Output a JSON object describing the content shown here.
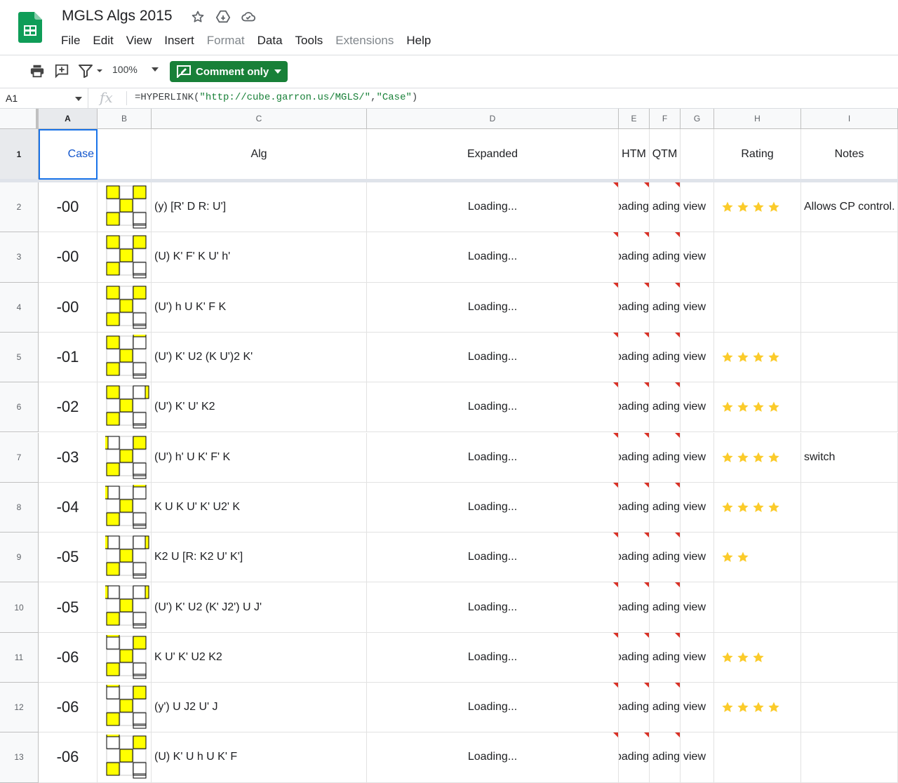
{
  "document": {
    "title": "MGLS Algs 2015",
    "title_icons": [
      "star-icon",
      "move-to-drive-icon",
      "cloud-saved-icon"
    ]
  },
  "menubar": [
    {
      "label": "File",
      "enabled": true
    },
    {
      "label": "Edit",
      "enabled": true
    },
    {
      "label": "View",
      "enabled": true
    },
    {
      "label": "Insert",
      "enabled": true
    },
    {
      "label": "Format",
      "enabled": false
    },
    {
      "label": "Data",
      "enabled": true
    },
    {
      "label": "Tools",
      "enabled": true
    },
    {
      "label": "Extensions",
      "enabled": false
    },
    {
      "label": "Help",
      "enabled": true
    }
  ],
  "toolbar": {
    "icons": [
      "print-icon",
      "add-comment-icon",
      "filter-icon"
    ],
    "zoom": "100%",
    "comment_only_label": "Comment only"
  },
  "formula_bar": {
    "cell_ref": "A1",
    "fx_label": "fx",
    "formula_prefix": "=HYPERLINK(",
    "formula_arg1": "\"http://cube.garron.us/MGLS/\"",
    "formula_sep": ",",
    "formula_arg2": "\"Case\"",
    "formula_suffix": ")"
  },
  "columns": [
    "A",
    "B",
    "C",
    "D",
    "E",
    "F",
    "G",
    "H",
    "I"
  ],
  "header_row": {
    "row_number": "1",
    "case": "Case",
    "alg": "Alg",
    "expanded": "Expanded",
    "htm": "HTM",
    "qtm": "QTM",
    "view": "",
    "rating": "Rating",
    "notes": "Notes"
  },
  "rows": [
    {
      "num": "2",
      "case": "-00",
      "alg": "(y) [R' D R: U']",
      "expanded": "Loading...",
      "htm": "oading",
      "qtm": "ading",
      "view": "view",
      "rating": 4,
      "notes": "Allows CP control.",
      "thumb": [
        [
          1,
          0,
          1
        ],
        [
          0,
          1,
          0
        ],
        [
          1,
          0,
          2
        ]
      ]
    },
    {
      "num": "3",
      "case": "-00",
      "alg": "(U) K' F' K U' h'",
      "expanded": "Loading...",
      "htm": "oading",
      "qtm": "ading",
      "view": "view",
      "rating": 0,
      "notes": "",
      "thumb": [
        [
          1,
          0,
          1
        ],
        [
          0,
          1,
          0
        ],
        [
          1,
          0,
          2
        ]
      ]
    },
    {
      "num": "4",
      "case": "-00",
      "alg": "(U') h U K' F K",
      "expanded": "Loading...",
      "htm": "oading",
      "qtm": "ading",
      "view": "view",
      "rating": 0,
      "notes": "",
      "thumb": [
        [
          1,
          0,
          1
        ],
        [
          0,
          1,
          0
        ],
        [
          1,
          0,
          2
        ]
      ]
    },
    {
      "num": "5",
      "case": "-01",
      "alg": "(U') K' U2 (K U')2 K'",
      "expanded": "Loading...",
      "htm": "oading",
      "qtm": "ading",
      "view": "view",
      "rating": 4,
      "notes": "",
      "thumb": [
        [
          1,
          0,
          3
        ],
        [
          0,
          1,
          0
        ],
        [
          1,
          0,
          2
        ]
      ]
    },
    {
      "num": "6",
      "case": "-02",
      "alg": "(U') K' U' K2",
      "expanded": "Loading...",
      "htm": "oading",
      "qtm": "ading",
      "view": "view",
      "rating": 4,
      "notes": "",
      "thumb": [
        [
          1,
          0,
          4
        ],
        [
          0,
          1,
          0
        ],
        [
          1,
          0,
          2
        ]
      ]
    },
    {
      "num": "7",
      "case": "-03",
      "alg": "(U') h' U K' F' K",
      "expanded": "Loading...",
      "htm": "oading",
      "qtm": "ading",
      "view": "view",
      "rating": 4,
      "notes": "switch",
      "thumb": [
        [
          5,
          0,
          1
        ],
        [
          0,
          1,
          0
        ],
        [
          1,
          0,
          2
        ]
      ]
    },
    {
      "num": "8",
      "case": "-04",
      "alg": "K U K U' K' U2' K",
      "expanded": "Loading...",
      "htm": "oading",
      "qtm": "ading",
      "view": "view",
      "rating": 4,
      "notes": "",
      "thumb": [
        [
          5,
          0,
          3
        ],
        [
          0,
          1,
          0
        ],
        [
          1,
          0,
          2
        ]
      ]
    },
    {
      "num": "9",
      "case": "-05",
      "alg": "K2 U [R: K2 U' K']",
      "expanded": "Loading...",
      "htm": "oading",
      "qtm": "ading",
      "view": "view",
      "rating": 2,
      "notes": "",
      "thumb": [
        [
          5,
          0,
          4
        ],
        [
          0,
          1,
          0
        ],
        [
          1,
          0,
          2
        ]
      ]
    },
    {
      "num": "10",
      "case": "-05",
      "alg": "(U') K' U2 (K' J2') U J'",
      "expanded": "Loading...",
      "htm": "oading",
      "qtm": "ading",
      "view": "view",
      "rating": 0,
      "notes": "",
      "thumb": [
        [
          5,
          0,
          4
        ],
        [
          0,
          1,
          0
        ],
        [
          1,
          0,
          2
        ]
      ]
    },
    {
      "num": "11",
      "case": "-06",
      "alg": "K U' K' U2 K2",
      "expanded": "Loading...",
      "htm": "oading",
      "qtm": "ading",
      "view": "view",
      "rating": 3,
      "notes": "",
      "thumb": [
        [
          3,
          0,
          1
        ],
        [
          0,
          1,
          0
        ],
        [
          1,
          0,
          2
        ]
      ]
    },
    {
      "num": "12",
      "case": "-06",
      "alg": "(y') U J2 U' J",
      "expanded": "Loading...",
      "htm": "oading",
      "qtm": "ading",
      "view": "view",
      "rating": 4,
      "notes": "",
      "thumb": [
        [
          3,
          0,
          1
        ],
        [
          0,
          1,
          0
        ],
        [
          1,
          0,
          2
        ]
      ]
    },
    {
      "num": "13",
      "case": "-06",
      "alg": "(U) K' U h U K' F",
      "expanded": "Loading...",
      "htm": "oading",
      "qtm": "ading",
      "view": "view",
      "rating": 0,
      "notes": "",
      "thumb": [
        [
          3,
          0,
          1
        ],
        [
          0,
          1,
          0
        ],
        [
          1,
          0,
          2
        ]
      ]
    }
  ],
  "colors": {
    "sheets_green": "#0f9d58",
    "comment_button": "#188038",
    "sticker_yellow": "#ffff00",
    "star_yellow": "#fbcb2a",
    "note_red": "#d93025",
    "link_blue": "#1155cc",
    "selection_blue": "#1a73e8"
  }
}
